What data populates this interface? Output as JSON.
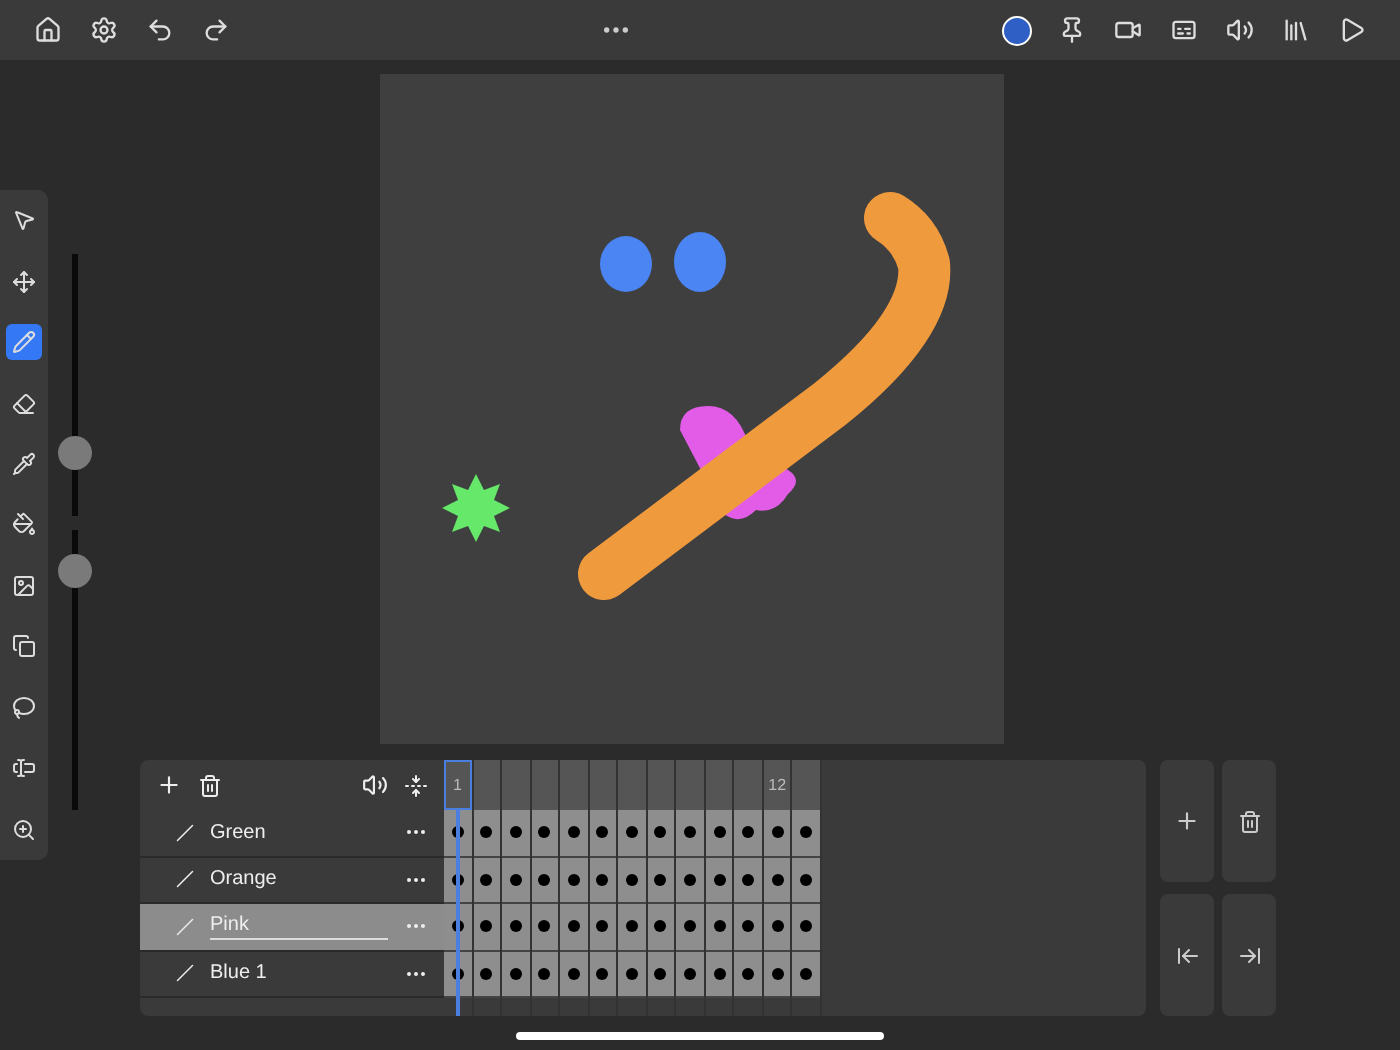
{
  "top_bar": {
    "color_swatch": {
      "color": "#2f5fc4"
    }
  },
  "tools": [
    {
      "kind": "select",
      "selected": false
    },
    {
      "kind": "move",
      "selected": false
    },
    {
      "kind": "brush",
      "selected": true
    },
    {
      "kind": "eraser",
      "selected": false
    },
    {
      "kind": "eyedropper",
      "selected": false
    },
    {
      "kind": "fill",
      "selected": false
    },
    {
      "kind": "image",
      "selected": false
    },
    {
      "kind": "layers",
      "selected": false
    },
    {
      "kind": "lasso",
      "selected": false
    },
    {
      "kind": "text",
      "selected": false
    },
    {
      "kind": "zoom",
      "selected": false
    }
  ],
  "sliders": [
    {
      "level": 0.2
    },
    {
      "level": 0.9
    }
  ],
  "timeline": {
    "frames": [
      {
        "label": "1",
        "selected": true
      },
      {
        "selected": false
      },
      {
        "selected": false
      },
      {
        "selected": false
      },
      {
        "selected": false
      },
      {
        "selected": false
      },
      {
        "selected": false
      },
      {
        "selected": false
      },
      {
        "selected": false
      },
      {
        "selected": false
      },
      {
        "selected": false
      },
      {
        "label": "12",
        "selected": false
      },
      {
        "selected": false
      }
    ],
    "layers": [
      {
        "name": "Green",
        "selected": false
      },
      {
        "name": "Orange",
        "selected": false
      },
      {
        "name": "Pink",
        "selected": true
      },
      {
        "name": "Blue 1",
        "selected": false
      }
    ]
  }
}
